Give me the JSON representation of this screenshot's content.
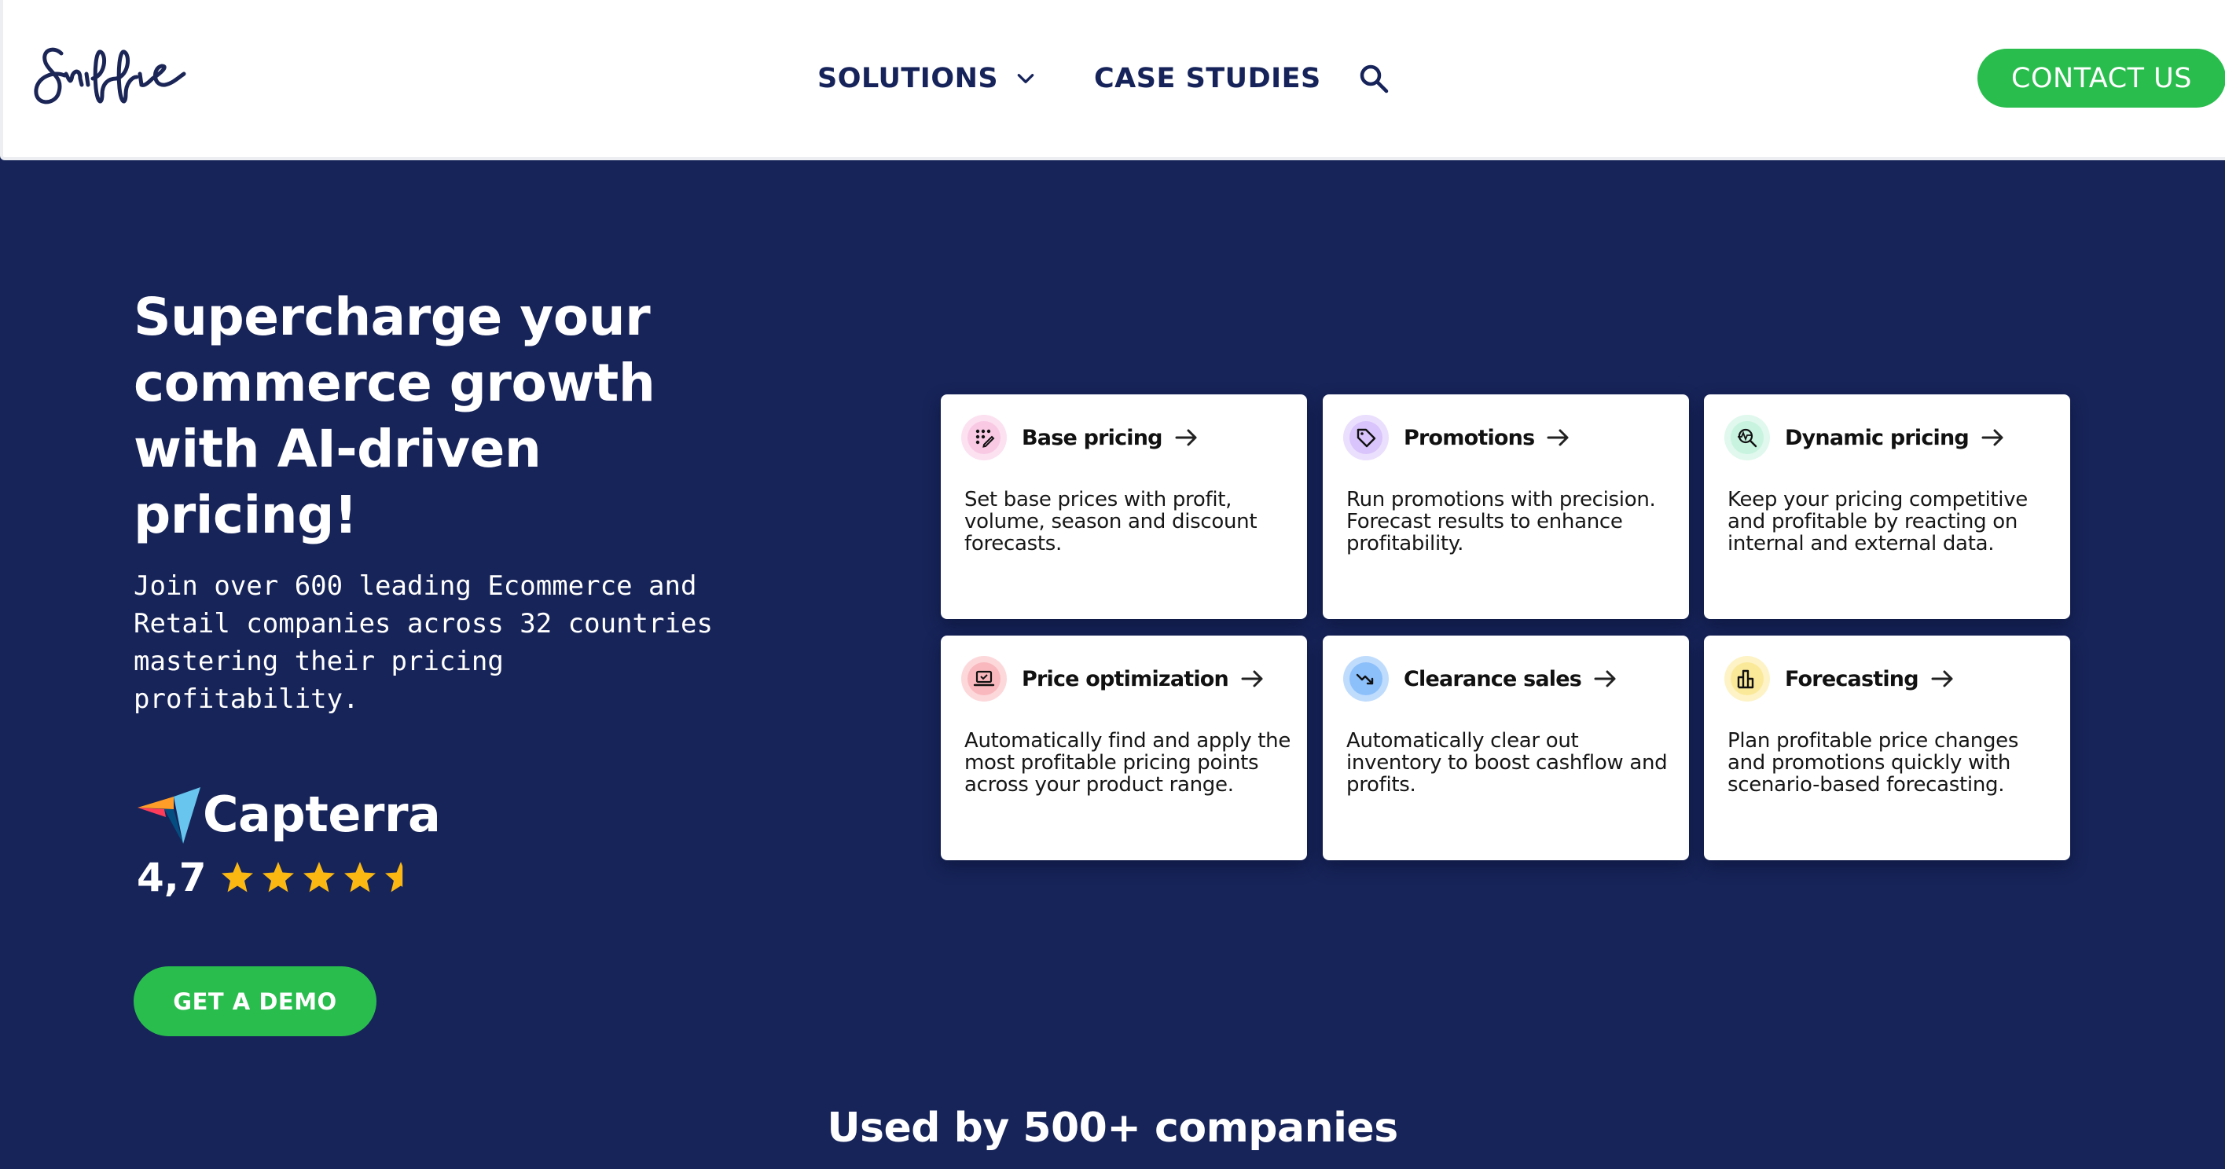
{
  "header": {
    "logo_text": "Sniffie",
    "nav": {
      "solutions_label": "SOLUTIONS",
      "case_studies_label": "CASE STUDIES"
    },
    "contact_label": "CONTACT US"
  },
  "hero": {
    "title": "Supercharge your commerce growth with AI-driven pricing!",
    "title_lines": [
      "Supercharge your",
      "commerce growth",
      "with AI-driven",
      "pricing!"
    ],
    "subtitle_lines": [
      "Join over 600 leading Ecommerce and",
      "Retail companies across 32 countries",
      "mastering their pricing",
      "profitability."
    ],
    "rating": {
      "brand": "Capterra",
      "score_text": "4,7",
      "score": 4.7,
      "max": 5
    },
    "demo_label": "GET A DEMO"
  },
  "cards": [
    {
      "title": "Base pricing",
      "icon": "grid-edit-icon",
      "icon_color": "#f9c9e4",
      "description": "Set base prices with profit, volume, season and discount forecasts."
    },
    {
      "title": "Promotions",
      "icon": "tag-icon",
      "icon_color": "#d9c4fb",
      "description": "Run promotions with precision. Forecast results to enhance profitability."
    },
    {
      "title": "Dynamic pricing",
      "icon": "search-chart-icon",
      "icon_color": "#c7f3df",
      "description": "Keep your pricing competitive and profitable by reacting on internal and external data."
    },
    {
      "title": "Price optimization",
      "icon": "laptop-check-icon",
      "icon_color": "#f9b8bd",
      "description": "Automatically find and apply the most profitable pricing points across your product range."
    },
    {
      "title": "Clearance sales",
      "icon": "trend-down-icon",
      "icon_color": "#8cc0fb",
      "description": "Automatically clear out inventory to boost cashflow and profits."
    },
    {
      "title": "Forecasting",
      "icon": "bar-chart-icon",
      "icon_color": "#fbe99a",
      "description": "Plan profitable price changes and promotions quickly with scenario-based forecasting."
    }
  ],
  "used_by": "Used by 500+ companies",
  "colors": {
    "navy": "#172459",
    "green": "#29bd4d",
    "nav_text": "#16235a",
    "star": "#fbb812"
  }
}
